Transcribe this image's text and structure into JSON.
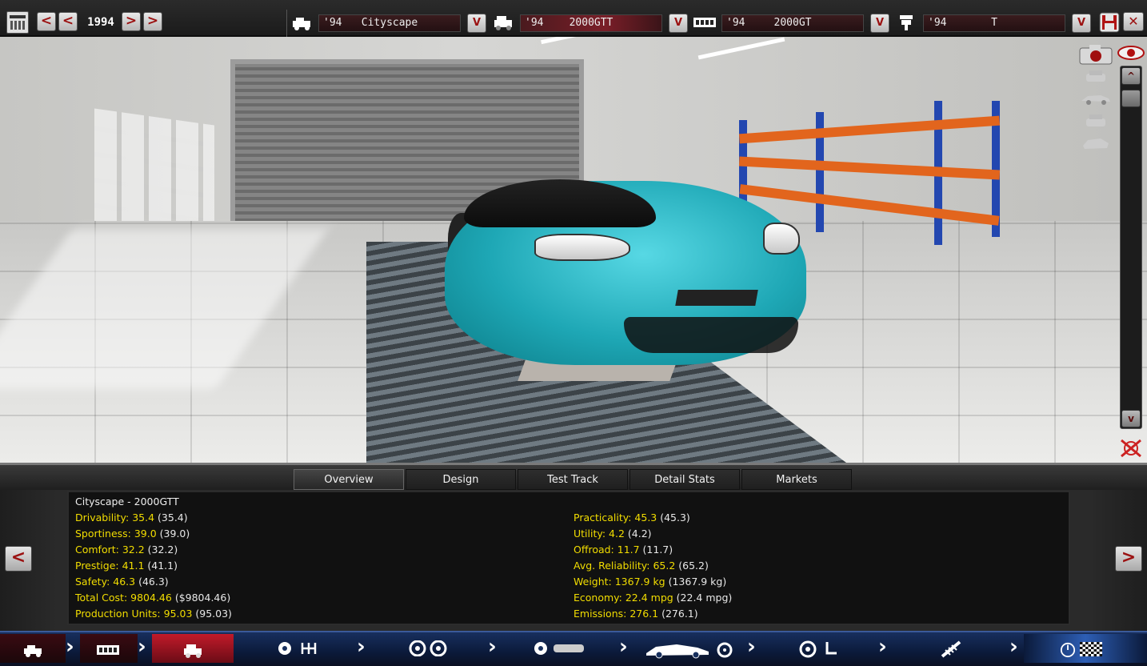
{
  "topbar": {
    "year": "1994",
    "prev_fast": "<",
    "prev": "<",
    "next": ">",
    "next_fast": ">",
    "model_selector": {
      "year": "'94",
      "name": "Cityscape",
      "dropdown": "V"
    },
    "trim_selector": {
      "year": "'94",
      "name": "2000GTT",
      "dropdown": "V"
    },
    "engine_selector": {
      "year": "'94",
      "name": "2000GT",
      "dropdown": "V"
    },
    "family_selector": {
      "year": "'94",
      "name": "T",
      "dropdown": "V"
    },
    "save_icon": "save-icon",
    "close": "✕"
  },
  "viewport": {
    "car_color": "#1ea7b5",
    "scroll_up": "^",
    "scroll_down": "v"
  },
  "tabs": [
    {
      "label": "Overview",
      "active": true
    },
    {
      "label": "Design",
      "active": false
    },
    {
      "label": "Test Track",
      "active": false
    },
    {
      "label": "Detail Stats",
      "active": false
    },
    {
      "label": "Markets",
      "active": false
    }
  ],
  "overview": {
    "title": "Cityscape - 2000GTT",
    "left": [
      {
        "k": "Drivability: 35.4",
        "p": " (35.4)"
      },
      {
        "k": "Sportiness: 39.0",
        "p": " (39.0)"
      },
      {
        "k": "Comfort: 32.2",
        "p": " (32.2)"
      },
      {
        "k": "Prestige: 41.1",
        "p": " (41.1)"
      },
      {
        "k": "Safety: 46.3",
        "p": " (46.3)"
      },
      {
        "k": "Total Cost: 9804.46",
        "p": " ($9804.46)"
      },
      {
        "k": "Production Units: 95.03",
        "p": " (95.03)"
      }
    ],
    "right": [
      {
        "k": "Practicality: 45.3",
        "p": " (45.3)"
      },
      {
        "k": "Utility: 4.2",
        "p": " (4.2)"
      },
      {
        "k": "Offroad: 11.7",
        "p": " (11.7)"
      },
      {
        "k": "Avg. Reliability: 65.2",
        "p": " (65.2)"
      },
      {
        "k": "Weight: 1367.9 kg",
        "p": " (1367.9 kg)"
      },
      {
        "k": "Economy: 22.4 mpg",
        "p": " (22.4 mpg)"
      },
      {
        "k": "Emissions: 276.1",
        "p": " (276.1)"
      }
    ],
    "prev_arrow": "<",
    "next_arrow": ">"
  },
  "bottomnav": {
    "accent_active": "#c11a2a",
    "accent_nav": "#182f5e",
    "chevron": "›"
  }
}
